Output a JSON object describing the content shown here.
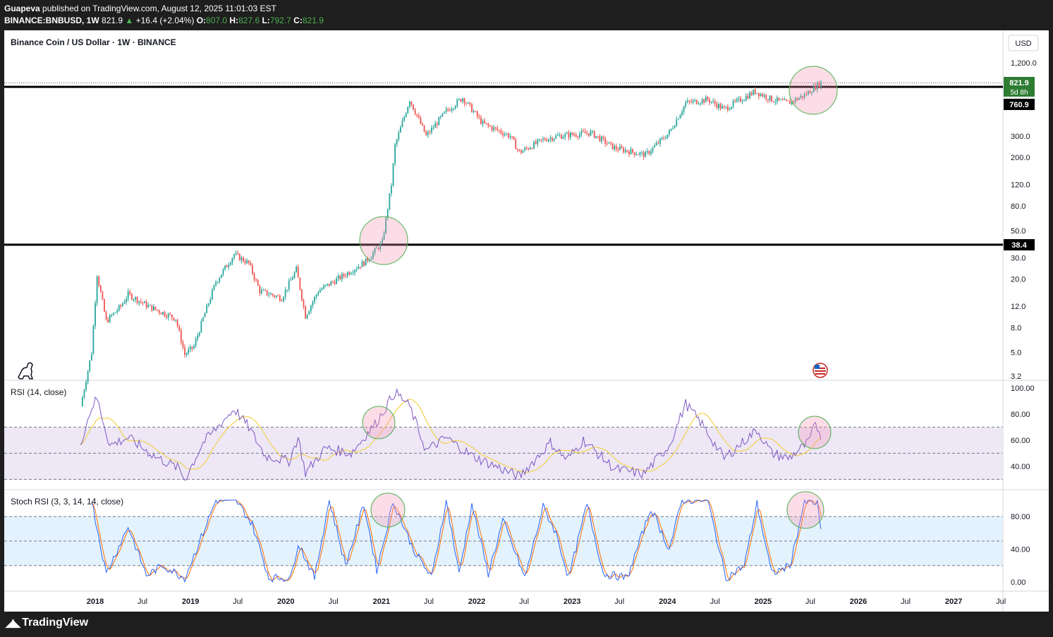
{
  "header": {
    "author": "Guapeva",
    "published": "published on TradingView.com, August 12, 2025 11:01:03 EST",
    "symbol": "BINANCE:BNBUSD, 1W",
    "last": "821.9",
    "change": "+16.4 (+2.04%)",
    "o_label": "O:",
    "o": "807.0",
    "h_label": "H:",
    "h": "827.6",
    "l_label": "L:",
    "l": "792.7",
    "c_label": "C:",
    "c": "821.9"
  },
  "chart_title": "Binance Coin / US Dollar · 1W · BINANCE",
  "currency": "USD",
  "price_badges": {
    "last": "821.9",
    "countdown": "5d 8h",
    "resistance": "760.9",
    "support": "38.4"
  },
  "rsi_title": "RSI (14, close)",
  "stoch_title": "Stoch RSI (3, 3, 14, 14, close)",
  "footer_brand": "TradingView",
  "icons": [
    "dino-icon",
    "us-flag-icon",
    "tradingview-logo-icon"
  ],
  "colors": {
    "up": "#26a69a",
    "down": "#ef5350",
    "rsi": "#7e57c2",
    "rsi_ma": "#f2d24b",
    "k": "#2962ff",
    "d": "#ff6d00"
  },
  "chart_data": [
    {
      "type": "candlestick",
      "title": "Binance Coin / US Dollar · 1W · BINANCE",
      "y_scale": "log",
      "y_ticks": [
        "1,200.0",
        "300.0",
        "200.0",
        "120.0",
        "80.0",
        "50.0",
        "30.0",
        "20.0",
        "12.0",
        "8.0",
        "5.0",
        "3.2"
      ],
      "x_ticks": [
        "2018",
        "Jul",
        "2019",
        "Jul",
        "2020",
        "Jul",
        "2021",
        "Jul",
        "2022",
        "Jul",
        "2023",
        "Jul",
        "2024",
        "Jul",
        "2025",
        "Jul",
        "2026",
        "Jul",
        "2027",
        "Jul"
      ],
      "horizontal_lines": [
        760.9,
        38.4
      ],
      "last_price": 821.9,
      "price_path": [
        [
          "2017-11-06",
          1.8
        ],
        [
          "2017-12-18",
          5
        ],
        [
          "2018-01-08",
          22
        ],
        [
          "2018-02-12",
          9
        ],
        [
          "2018-04-09",
          12
        ],
        [
          "2018-05-07",
          15
        ],
        [
          "2018-07-23",
          12
        ],
        [
          "2018-11-05",
          9.5
        ],
        [
          "2018-12-10",
          4.8
        ],
        [
          "2019-01-14",
          5.6
        ],
        [
          "2019-02-18",
          9.5
        ],
        [
          "2019-04-08",
          19
        ],
        [
          "2019-06-17",
          32
        ],
        [
          "2019-08-12",
          27
        ],
        [
          "2019-09-23",
          16
        ],
        [
          "2019-12-16",
          14
        ],
        [
          "2020-02-10",
          24
        ],
        [
          "2020-03-16",
          10
        ],
        [
          "2020-05-04",
          16
        ],
        [
          "2020-08-17",
          22
        ],
        [
          "2020-11-02",
          28
        ],
        [
          "2021-01-04",
          40
        ],
        [
          "2021-02-08",
          120
        ],
        [
          "2021-02-22",
          250
        ],
        [
          "2021-04-19",
          600
        ],
        [
          "2021-06-21",
          300
        ],
        [
          "2021-09-06",
          480
        ],
        [
          "2021-11-08",
          620
        ],
        [
          "2022-01-24",
          380
        ],
        [
          "2022-05-09",
          300
        ],
        [
          "2022-06-13",
          220
        ],
        [
          "2022-09-12",
          280
        ],
        [
          "2022-11-07",
          300
        ],
        [
          "2023-03-13",
          320
        ],
        [
          "2023-06-12",
          240
        ],
        [
          "2023-10-09",
          210
        ],
        [
          "2024-01-08",
          320
        ],
        [
          "2024-03-11",
          560
        ],
        [
          "2024-06-03",
          600
        ],
        [
          "2024-08-05",
          500
        ],
        [
          "2024-12-02",
          700
        ],
        [
          "2025-02-03",
          600
        ],
        [
          "2025-04-07",
          560
        ],
        [
          "2025-06-09",
          650
        ],
        [
          "2025-07-28",
          790
        ],
        [
          "2025-08-11",
          821.9
        ]
      ]
    },
    {
      "type": "line",
      "title": "RSI (14, close)",
      "y_ticks": [
        "100.00",
        "80.00",
        "60.00",
        "40.00"
      ],
      "bands": [
        70,
        50,
        30
      ],
      "series": [
        {
          "values": [
            [
              "2017-11-06",
              58
            ],
            [
              "2017-12-18",
              85
            ],
            [
              "2018-01-08",
              92
            ],
            [
              "2018-02-26",
              56
            ],
            [
              "2018-05-07",
              62
            ],
            [
              "2018-08-13",
              48
            ],
            [
              "2018-11-19",
              38
            ],
            [
              "2018-12-10",
              30
            ],
            [
              "2019-02-18",
              58
            ],
            [
              "2019-06-17",
              84
            ],
            [
              "2019-08-12",
              70
            ],
            [
              "2019-10-14",
              48
            ],
            [
              "2020-01-13",
              44
            ],
            [
              "2020-02-17",
              62
            ],
            [
              "2020-03-16",
              35
            ],
            [
              "2020-06-01",
              54
            ],
            [
              "2020-09-07",
              50
            ],
            [
              "2020-12-14",
              74
            ],
            [
              "2021-02-22",
              97
            ],
            [
              "2021-04-19",
              86
            ],
            [
              "2021-06-21",
              52
            ],
            [
              "2021-09-06",
              62
            ],
            [
              "2021-12-13",
              48
            ],
            [
              "2022-06-13",
              32
            ],
            [
              "2022-10-10",
              58
            ],
            [
              "2022-12-12",
              45
            ],
            [
              "2023-02-13",
              60
            ],
            [
              "2023-06-12",
              38
            ],
            [
              "2023-10-02",
              34
            ],
            [
              "2024-01-08",
              56
            ],
            [
              "2024-03-11",
              88
            ],
            [
              "2024-05-13",
              72
            ],
            [
              "2024-08-05",
              46
            ],
            [
              "2024-12-09",
              68
            ],
            [
              "2025-02-03",
              50
            ],
            [
              "2025-04-07",
              46
            ],
            [
              "2025-06-23",
              58
            ],
            [
              "2025-07-21",
              72
            ],
            [
              "2025-08-11",
              64
            ]
          ]
        }
      ]
    },
    {
      "type": "line",
      "title": "Stoch RSI (3, 3, 14, 14, close)",
      "y_ticks": [
        "80.00",
        "40.00",
        "0.00"
      ],
      "bands": [
        80,
        50,
        20
      ],
      "series": [
        {
          "values": [
            [
              "2017-12-18",
              100
            ],
            [
              "2018-02-12",
              10
            ],
            [
              "2018-05-07",
              68
            ],
            [
              "2018-07-16",
              8
            ],
            [
              "2018-09-17",
              20
            ],
            [
              "2018-12-10",
              5
            ],
            [
              "2019-02-18",
              60
            ],
            [
              "2019-04-08",
              100
            ],
            [
              "2019-06-24",
              100
            ],
            [
              "2019-08-26",
              70
            ],
            [
              "2019-10-28",
              5
            ],
            [
              "2020-01-20",
              5
            ],
            [
              "2020-02-17",
              48
            ],
            [
              "2020-04-20",
              5
            ],
            [
              "2020-06-15",
              100
            ],
            [
              "2020-08-17",
              20
            ],
            [
              "2020-10-26",
              95
            ],
            [
              "2020-12-14",
              15
            ],
            [
              "2021-02-15",
              98
            ],
            [
              "2021-05-03",
              40
            ],
            [
              "2021-07-12",
              5
            ],
            [
              "2021-09-06",
              100
            ],
            [
              "2021-10-25",
              10
            ],
            [
              "2021-12-13",
              95
            ],
            [
              "2022-02-14",
              10
            ],
            [
              "2022-04-11",
              75
            ],
            [
              "2022-07-04",
              5
            ],
            [
              "2022-09-12",
              92
            ],
            [
              "2022-10-31",
              60
            ],
            [
              "2022-12-19",
              5
            ],
            [
              "2023-02-27",
              95
            ],
            [
              "2023-05-01",
              10
            ],
            [
              "2023-07-31",
              5
            ],
            [
              "2023-10-30",
              90
            ],
            [
              "2024-01-08",
              40
            ],
            [
              "2024-02-26",
              100
            ],
            [
              "2024-06-03",
              100
            ],
            [
              "2024-08-12",
              5
            ],
            [
              "2024-10-21",
              20
            ],
            [
              "2024-12-09",
              96
            ],
            [
              "2025-02-03",
              10
            ],
            [
              "2025-04-14",
              20
            ],
            [
              "2025-06-09",
              98
            ],
            [
              "2025-07-28",
              96
            ],
            [
              "2025-08-11",
              60
            ]
          ]
        }
      ]
    }
  ]
}
